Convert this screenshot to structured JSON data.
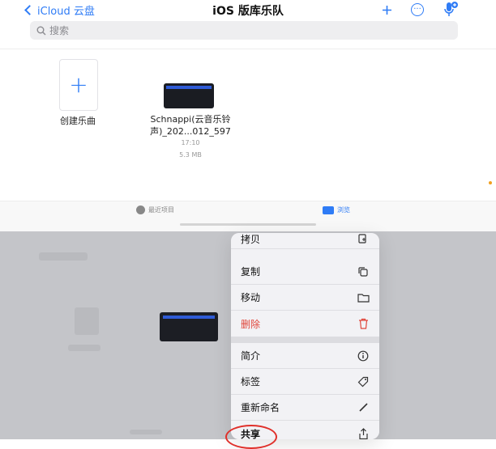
{
  "nav": {
    "back_label": "iCloud 云盘",
    "title": "iOS 版库乐队",
    "search_placeholder": "搜索"
  },
  "browser": {
    "create_label": "创建乐曲",
    "file": {
      "name_line1": "Schnappi(云音乐铃",
      "name_line2": "声)_202...012_597",
      "time": "17:10",
      "size": "5.3 MB"
    }
  },
  "tabs": {
    "recent": "最近项目",
    "browse": "浏览"
  },
  "menu": {
    "items": [
      {
        "label": "拷贝",
        "icon": "copy-doc-icon"
      },
      {
        "label": "复制",
        "icon": "duplicate-icon"
      },
      {
        "label": "移动",
        "icon": "folder-icon"
      },
      {
        "label": "删除",
        "icon": "trash-icon"
      },
      {
        "label": "简介",
        "icon": "info-icon"
      },
      {
        "label": "标签",
        "icon": "tag-icon"
      },
      {
        "label": "重新命名",
        "icon": "pencil-icon"
      },
      {
        "label": "共享",
        "icon": "share-icon"
      }
    ]
  },
  "colors": {
    "accent": "#2f7cf6",
    "danger": "#e0453a",
    "annotation": "#e0302a"
  }
}
